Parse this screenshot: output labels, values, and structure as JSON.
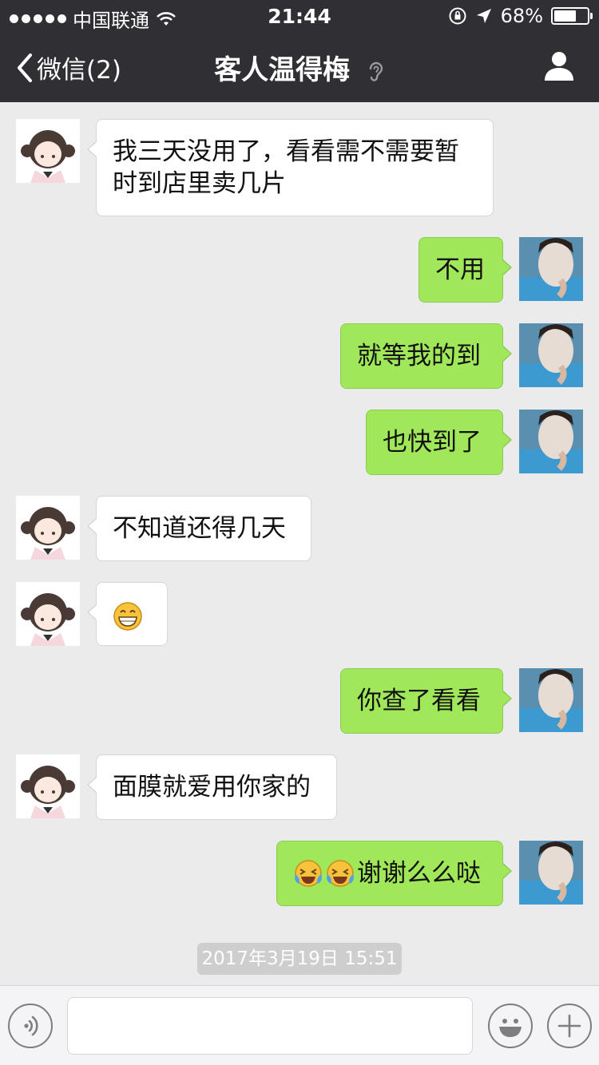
{
  "status_bar": {
    "carrier": "中国联通",
    "time": "21:44",
    "battery": "68%",
    "battery_level": 0.68,
    "icons": [
      "signal-dots",
      "wifi-icon",
      "orientation-lock-icon",
      "location-arrow-icon",
      "battery-icon"
    ]
  },
  "nav": {
    "back_label": "微信(2)",
    "title": "客人温得梅",
    "title_icon": "ear-icon",
    "right_icon": "profile-icon"
  },
  "messages": [
    {
      "side": "left",
      "text": "我三天没用了，看看需不需要暂时到店里卖几片"
    },
    {
      "side": "right",
      "text": "不用"
    },
    {
      "side": "right",
      "text": "就等我的到"
    },
    {
      "side": "right",
      "text": "也快到了"
    },
    {
      "side": "left",
      "text": "不知道还得几天"
    },
    {
      "side": "left",
      "emoji": "grinning-face"
    },
    {
      "side": "right",
      "text": "你查了看看"
    },
    {
      "side": "left",
      "text": "面膜就爱用你家的"
    },
    {
      "side": "right",
      "emoji": "crying-laughing-face ×2",
      "text": "谢谢么么哒"
    }
  ],
  "timestamp": "2017年3月19日 15:51",
  "input_bar": {
    "text": "",
    "icons": [
      "voice-icon",
      "emoji-icon",
      "plus-icon"
    ]
  },
  "colors": {
    "nav_bg": "#2f2f34",
    "chat_bg": "#ebebeb",
    "self_bubble": "#a0e75a",
    "other_bubble": "#ffffff"
  }
}
